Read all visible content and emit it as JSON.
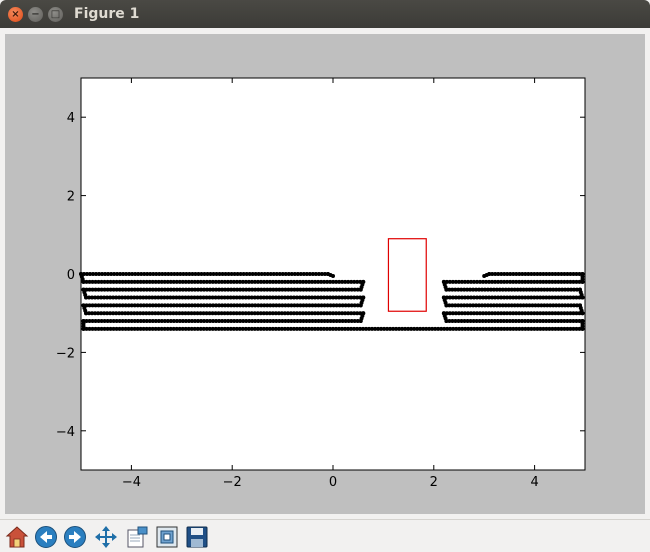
{
  "window": {
    "title": "Figure 1"
  },
  "titlebar_buttons": [
    {
      "name": "close",
      "glyph": "×"
    },
    {
      "name": "minimize",
      "glyph": "−"
    },
    {
      "name": "maximize",
      "glyph": "□"
    }
  ],
  "chart_data": {
    "type": "scatter",
    "title": "",
    "xlabel": "",
    "ylabel": "",
    "xlim": [
      -5,
      5
    ],
    "ylim": [
      -5,
      5
    ],
    "xticks": [
      -4,
      -2,
      0,
      2,
      4
    ],
    "yticks": [
      4,
      2,
      0,
      -2,
      -4
    ],
    "xtick_labels": [
      "−4",
      "−2",
      "0",
      "2",
      "4"
    ],
    "ytick_labels": [
      "4",
      "2",
      "0",
      "−2",
      "−4"
    ],
    "grid": false,
    "series": [
      {
        "color": "#000000",
        "marker": "dot",
        "segments": [
          {
            "x": [
              -5.0,
              -0.1
            ],
            "y": [
              0.0,
              0.0
            ]
          },
          {
            "x": [
              -0.1,
              0.0
            ],
            "y": [
              0.0,
              -0.05
            ]
          },
          {
            "x": [
              -5.0,
              -4.95
            ],
            "y": [
              0.0,
              -0.2
            ]
          },
          {
            "x": [
              -4.95,
              0.6
            ],
            "y": [
              -0.2,
              -0.2
            ]
          },
          {
            "x": [
              0.6,
              0.55
            ],
            "y": [
              -0.2,
              -0.4
            ]
          },
          {
            "x": [
              -4.95,
              0.55
            ],
            "y": [
              -0.4,
              -0.4
            ]
          },
          {
            "x": [
              -4.95,
              -4.9
            ],
            "y": [
              -0.4,
              -0.6
            ]
          },
          {
            "x": [
              -4.9,
              0.6
            ],
            "y": [
              -0.6,
              -0.6
            ]
          },
          {
            "x": [
              0.6,
              0.55
            ],
            "y": [
              -0.6,
              -0.8
            ]
          },
          {
            "x": [
              -4.95,
              0.55
            ],
            "y": [
              -0.8,
              -0.8
            ]
          },
          {
            "x": [
              -4.95,
              -4.9
            ],
            "y": [
              -0.8,
              -1.0
            ]
          },
          {
            "x": [
              -4.9,
              0.6
            ],
            "y": [
              -1.0,
              -1.0
            ]
          },
          {
            "x": [
              0.6,
              0.55
            ],
            "y": [
              -1.0,
              -1.2
            ]
          },
          {
            "x": [
              -4.95,
              0.55
            ],
            "y": [
              -1.2,
              -1.2
            ]
          },
          {
            "x": [
              -4.95,
              -4.95
            ],
            "y": [
              -1.2,
              -1.4
            ]
          },
          {
            "x": [
              -4.95,
              4.95
            ],
            "y": [
              -1.4,
              -1.4
            ]
          },
          {
            "x": [
              4.95,
              4.95
            ],
            "y": [
              -1.4,
              -1.2
            ]
          },
          {
            "x": [
              2.25,
              4.95
            ],
            "y": [
              -1.2,
              -1.2
            ]
          },
          {
            "x": [
              2.25,
              2.2
            ],
            "y": [
              -1.2,
              -1.0
            ]
          },
          {
            "x": [
              2.2,
              4.95
            ],
            "y": [
              -1.0,
              -1.0
            ]
          },
          {
            "x": [
              4.95,
              4.9
            ],
            "y": [
              -1.0,
              -0.8
            ]
          },
          {
            "x": [
              2.25,
              4.9
            ],
            "y": [
              -0.8,
              -0.8
            ]
          },
          {
            "x": [
              2.25,
              2.2
            ],
            "y": [
              -0.8,
              -0.6
            ]
          },
          {
            "x": [
              2.2,
              4.95
            ],
            "y": [
              -0.6,
              -0.6
            ]
          },
          {
            "x": [
              4.95,
              4.9
            ],
            "y": [
              -0.6,
              -0.4
            ]
          },
          {
            "x": [
              2.25,
              4.9
            ],
            "y": [
              -0.4,
              -0.4
            ]
          },
          {
            "x": [
              2.25,
              2.2
            ],
            "y": [
              -0.4,
              -0.2
            ]
          },
          {
            "x": [
              2.2,
              4.95
            ],
            "y": [
              -0.2,
              -0.2
            ]
          },
          {
            "x": [
              4.95,
              4.95
            ],
            "y": [
              -0.2,
              0.0
            ]
          },
          {
            "x": [
              3.1,
              4.95
            ],
            "y": [
              0.0,
              0.0
            ]
          },
          {
            "x": [
              3.0,
              3.1
            ],
            "y": [
              -0.05,
              0.0
            ]
          }
        ]
      }
    ],
    "annotations": [
      {
        "type": "rectangle",
        "color": "#e00000",
        "x": [
          1.1,
          1.85
        ],
        "y": [
          -0.95,
          0.9
        ]
      }
    ]
  },
  "toolbar": {
    "buttons": [
      {
        "name": "home",
        "icon": "home-icon"
      },
      {
        "name": "back",
        "icon": "back-arrow-icon"
      },
      {
        "name": "forward",
        "icon": "forward-arrow-icon"
      },
      {
        "name": "pan",
        "icon": "pan-move-icon"
      },
      {
        "name": "zoom",
        "icon": "zoom-edit-icon"
      },
      {
        "name": "configure",
        "icon": "subplots-configure-icon"
      },
      {
        "name": "save",
        "icon": "save-floppy-icon"
      }
    ]
  }
}
